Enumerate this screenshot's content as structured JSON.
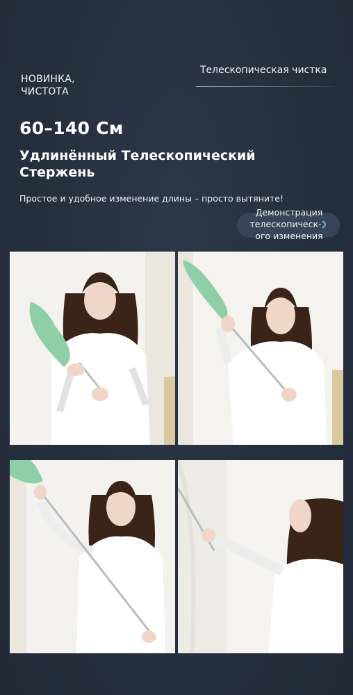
{
  "header": {
    "badge_line1": "НОВИНКА,",
    "badge_line2": "ЧИСТОТА",
    "tag": "Телескопическая чистка"
  },
  "main": {
    "size_title": "60–140 См",
    "headline_line1": "Удлинённый Телескопический",
    "headline_line2": "Стержень",
    "subline": "Простое и удобное изменение длины – просто вытяните!",
    "demo_line1": "Демонстрация",
    "demo_line2": "телескопическ-",
    "demo_line3": "ого изменения"
  },
  "colors": {
    "background": "#252e3d",
    "duster_green": "#8fcfa6",
    "dress_white": "#ffffff",
    "hair_brown": "#3a2417"
  },
  "icons": {
    "demo_badge_icon": "play-dot-icon"
  }
}
